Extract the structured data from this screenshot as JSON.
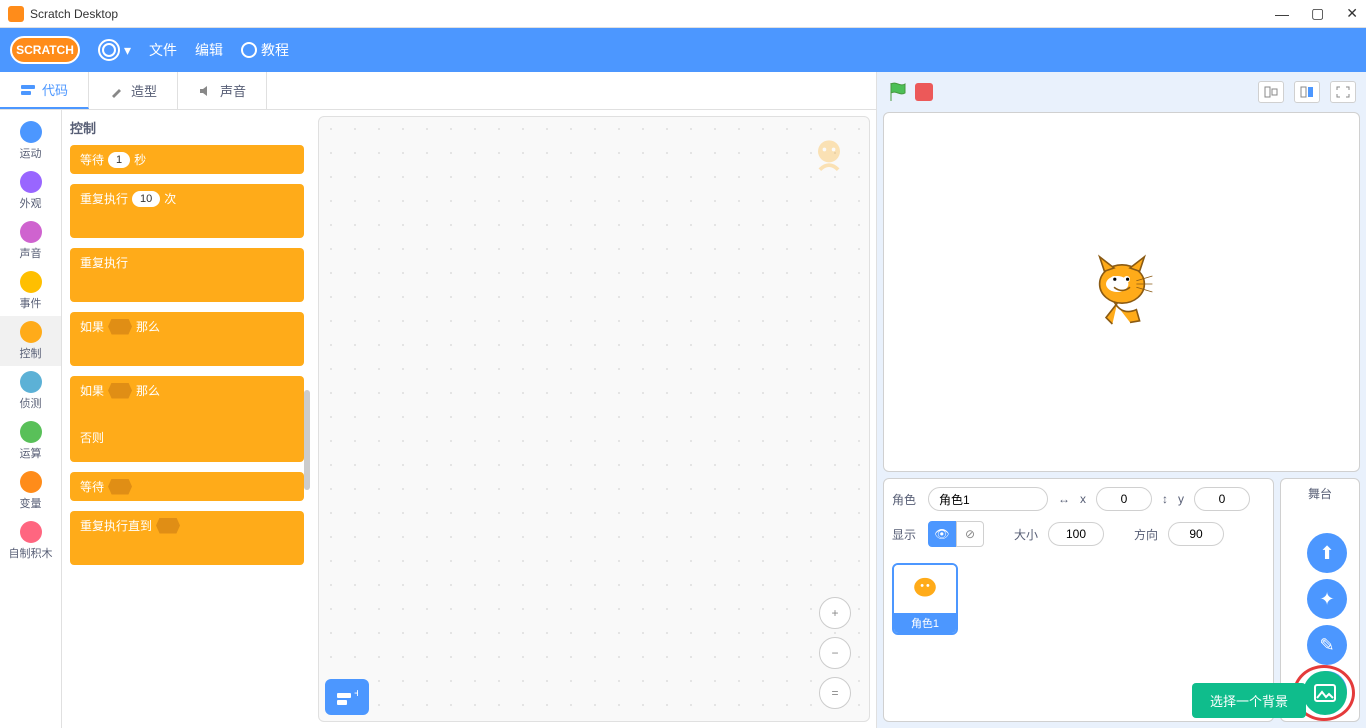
{
  "window": {
    "title": "Scratch Desktop"
  },
  "menu": {
    "logo": "SCRATCH",
    "file": "文件",
    "edit": "编辑",
    "tutorials": "教程"
  },
  "tabs": {
    "code": "代码",
    "costumes": "造型",
    "sounds": "声音"
  },
  "categories": [
    {
      "label": "运动",
      "color": "#4c97ff"
    },
    {
      "label": "外观",
      "color": "#9966ff"
    },
    {
      "label": "声音",
      "color": "#cf63cf"
    },
    {
      "label": "事件",
      "color": "#ffbf00"
    },
    {
      "label": "控制",
      "color": "#ffab19",
      "selected": true
    },
    {
      "label": "侦测",
      "color": "#5cb1d6"
    },
    {
      "label": "运算",
      "color": "#59c059"
    },
    {
      "label": "变量",
      "color": "#ff8c1a"
    },
    {
      "label": "自制积木",
      "color": "#ff6680"
    }
  ],
  "palette": {
    "title": "控制",
    "blocks": {
      "wait": {
        "pre": "等待",
        "val": "1",
        "post": "秒"
      },
      "repeat": {
        "pre": "重复执行",
        "val": "10",
        "post": "次"
      },
      "forever": "重复执行",
      "if": {
        "pre": "如果",
        "post": "那么"
      },
      "ifelse": {
        "pre": "如果",
        "post": "那么",
        "else": "否则"
      },
      "waituntil": "等待",
      "repeatuntil": "重复执行直到"
    }
  },
  "sprite": {
    "label": "角色",
    "name": "角色1",
    "xlabel": "x",
    "x": "0",
    "ylabel": "y",
    "y": "0",
    "showLabel": "显示",
    "sizeLabel": "大小",
    "size": "100",
    "dirLabel": "方向",
    "dir": "90",
    "card": "角色1"
  },
  "stagePanel": {
    "label": "舞台"
  },
  "backdrop": {
    "choose": "选择一个背景"
  }
}
